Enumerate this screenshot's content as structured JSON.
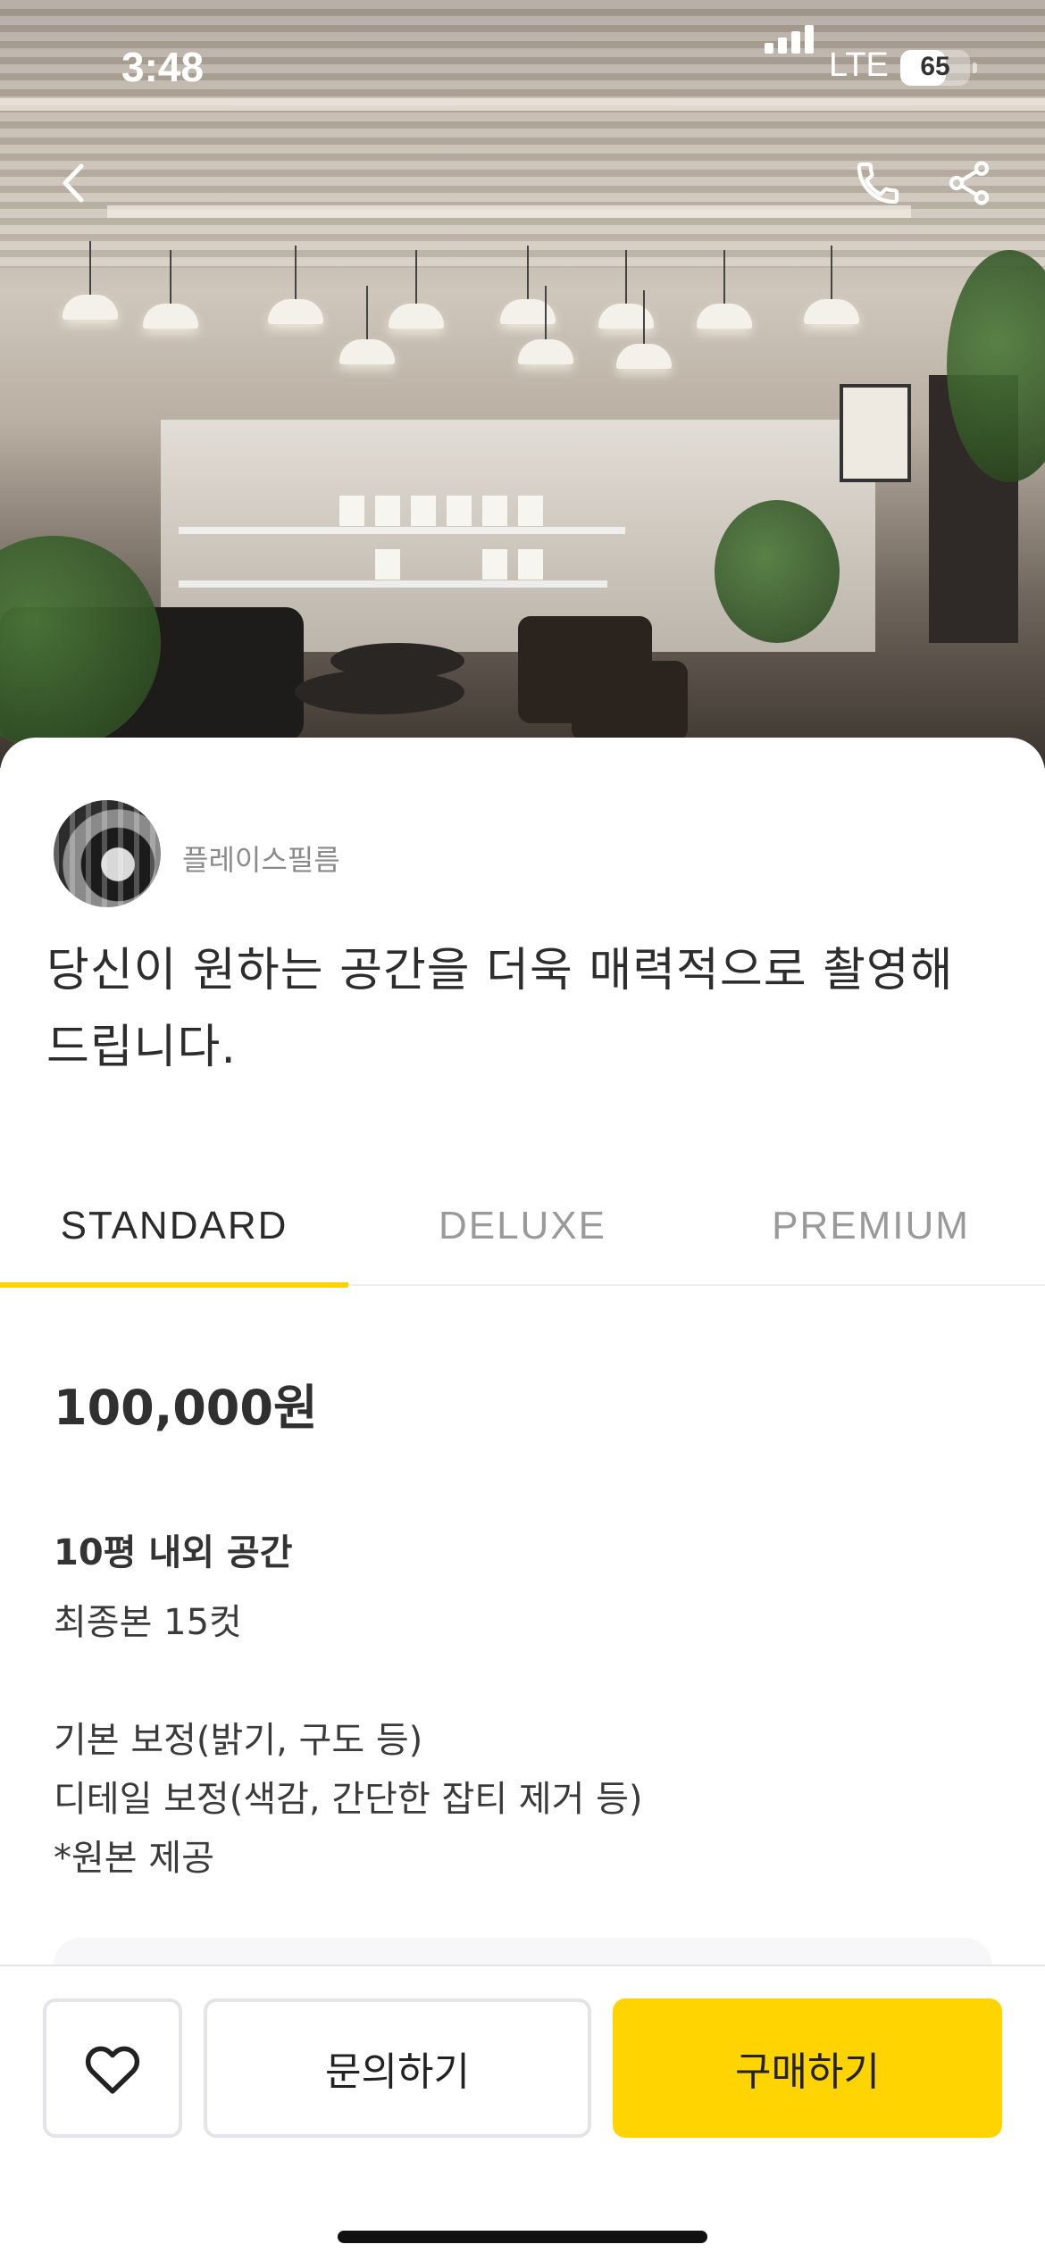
{
  "status_bar": {
    "time": "3:48",
    "network": "LTE",
    "battery": "65",
    "battery_level": 0.65
  },
  "header": {
    "back_icon": "chevron-left-icon",
    "call_icon": "phone-icon",
    "share_icon": "share-icon"
  },
  "seller": {
    "name": "플레이스필름"
  },
  "product": {
    "title": "당신이 원하는 공간을 더욱 매력적으로 촬영해 드립니다."
  },
  "tabs": [
    {
      "label": "STANDARD",
      "active": true
    },
    {
      "label": "DELUXE",
      "active": false
    },
    {
      "label": "PREMIUM",
      "active": false
    }
  ],
  "package": {
    "price": "100,000원",
    "heading": "10평 내외 공간",
    "lines": [
      "최종본 15컷",
      "기본 보정(밝기, 구도 등)",
      "디테일 보정(색감, 간단한 잡티 제거 등)",
      "*원본 제공"
    ]
  },
  "actions": {
    "like_icon": "heart-icon",
    "inquire_label": "문의하기",
    "buy_label": "구매하기"
  },
  "colors": {
    "accent": "#FFD400",
    "tab_underline": "#FFD200"
  }
}
